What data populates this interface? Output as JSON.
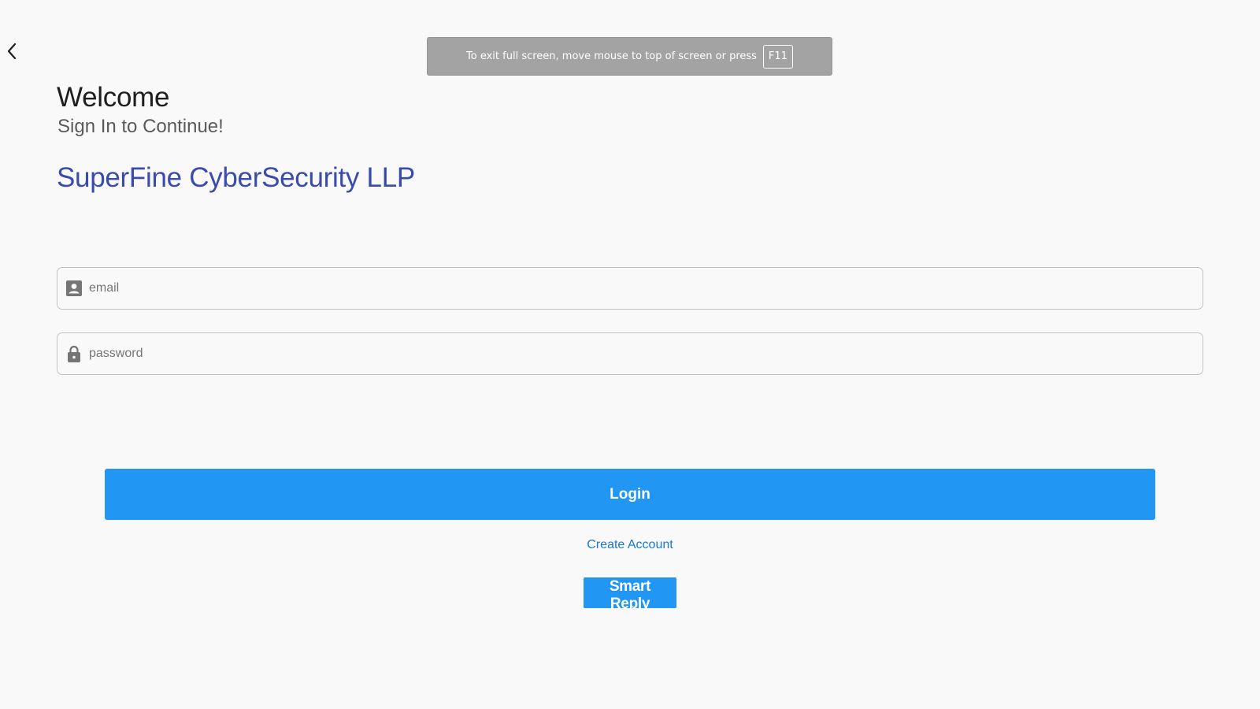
{
  "nav": {
    "back_icon": "chevron-left-icon"
  },
  "fullscreen_banner": {
    "message": "To exit full screen, move mouse to top of screen or press",
    "key": "F11"
  },
  "header": {
    "title": "Welcome",
    "subtitle": "Sign In to Continue!",
    "company": "SuperFine CyberSecurity LLP"
  },
  "form": {
    "email": {
      "placeholder": "email",
      "value": "",
      "icon": "account-box-icon"
    },
    "password": {
      "placeholder": "password",
      "value": "",
      "icon": "lock-icon"
    },
    "login_label": "Login",
    "create_account_label": "Create Account",
    "smart_reply_label": "Smart Reply"
  },
  "colors": {
    "background": "#f9f9f9",
    "primary_button": "#2196f3",
    "company_text": "#3a4bae",
    "link": "#1976d2",
    "banner": "#a3a3a3"
  }
}
